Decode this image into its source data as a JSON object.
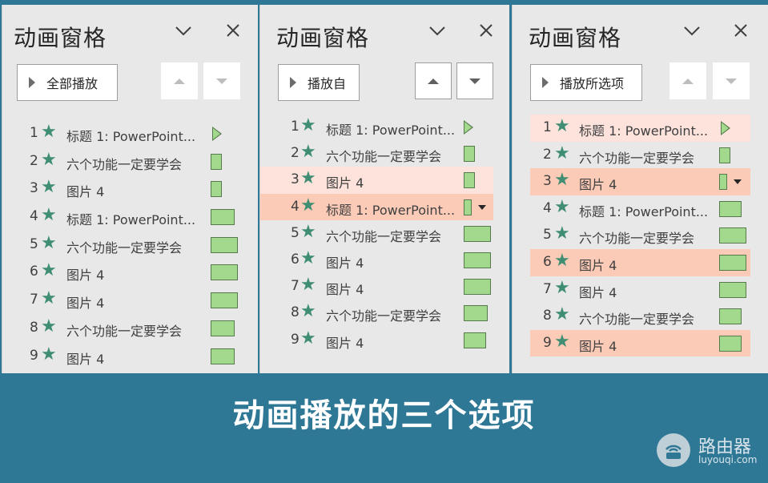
{
  "panes": [
    {
      "title": "动画窗格",
      "play_button": "全部播放",
      "up_active": false,
      "down_active": false,
      "rows": [
        {
          "num": "1",
          "label": "标题 1: PowerPoint...",
          "mark": "play",
          "hl": ""
        },
        {
          "num": "2",
          "label": "六个功能一定要学会",
          "mark": "bar",
          "hl": ""
        },
        {
          "num": "3",
          "label": "图片 4",
          "mark": "bar",
          "hl": ""
        },
        {
          "num": "4",
          "label": "标题 1: PowerPoint...",
          "mark": "bar",
          "hl": ""
        },
        {
          "num": "5",
          "label": "六个功能一定要学会",
          "mark": "bar",
          "hl": ""
        },
        {
          "num": "6",
          "label": "图片 4",
          "mark": "bar",
          "hl": ""
        },
        {
          "num": "7",
          "label": "图片 4",
          "mark": "bar",
          "hl": ""
        },
        {
          "num": "8",
          "label": "六个功能一定要学会",
          "mark": "bar",
          "hl": ""
        },
        {
          "num": "9",
          "label": "图片 4",
          "mark": "bar",
          "hl": ""
        }
      ]
    },
    {
      "title": "动画窗格",
      "play_button": "播放自",
      "up_active": true,
      "down_active": true,
      "rows": [
        {
          "num": "1",
          "label": "标题 1: PowerPoint...",
          "mark": "play",
          "hl": ""
        },
        {
          "num": "2",
          "label": "六个功能一定要学会",
          "mark": "bar",
          "hl": ""
        },
        {
          "num": "3",
          "label": "图片 4",
          "mark": "bar",
          "hl": "light"
        },
        {
          "num": "4",
          "label": "标题 1: PowerPoint...",
          "mark": "bar",
          "hl": "strong",
          "dropdown": true
        },
        {
          "num": "5",
          "label": "六个功能一定要学会",
          "mark": "bar",
          "hl": ""
        },
        {
          "num": "6",
          "label": "图片 4",
          "mark": "bar",
          "hl": ""
        },
        {
          "num": "7",
          "label": "图片 4",
          "mark": "bar",
          "hl": ""
        },
        {
          "num": "8",
          "label": "六个功能一定要学会",
          "mark": "bar",
          "hl": ""
        },
        {
          "num": "9",
          "label": "图片 4",
          "mark": "bar",
          "hl": ""
        }
      ]
    },
    {
      "title": "动画窗格",
      "play_button": "播放所选项",
      "up_active": false,
      "down_active": false,
      "rows": [
        {
          "num": "1",
          "label": "标题 1: PowerPoint...",
          "mark": "play",
          "hl": "light"
        },
        {
          "num": "2",
          "label": "六个功能一定要学会",
          "mark": "bar",
          "hl": ""
        },
        {
          "num": "3",
          "label": "图片 4",
          "mark": "bar",
          "hl": "strong",
          "dropdown": true
        },
        {
          "num": "4",
          "label": "标题 1: PowerPoint...",
          "mark": "bar",
          "hl": ""
        },
        {
          "num": "5",
          "label": "六个功能一定要学会",
          "mark": "bar",
          "hl": ""
        },
        {
          "num": "6",
          "label": "图片 4",
          "mark": "bar",
          "hl": "strong"
        },
        {
          "num": "7",
          "label": "图片 4",
          "mark": "bar",
          "hl": ""
        },
        {
          "num": "8",
          "label": "六个功能一定要学会",
          "mark": "bar",
          "hl": ""
        },
        {
          "num": "9",
          "label": "图片 4",
          "mark": "bar",
          "hl": "strong"
        }
      ]
    }
  ],
  "banner": {
    "text": "动画播放的三个选项"
  },
  "watermark": {
    "name": "路由器",
    "url": "luyouqi.com"
  },
  "colors": {
    "accent_bg": "#2e7896",
    "pane_bg": "#e8e8e8",
    "bar_fill": "#a2d98d",
    "highlight_light": "#fde3dc",
    "highlight_strong": "#fccbb7",
    "star": "#3f8d72"
  }
}
